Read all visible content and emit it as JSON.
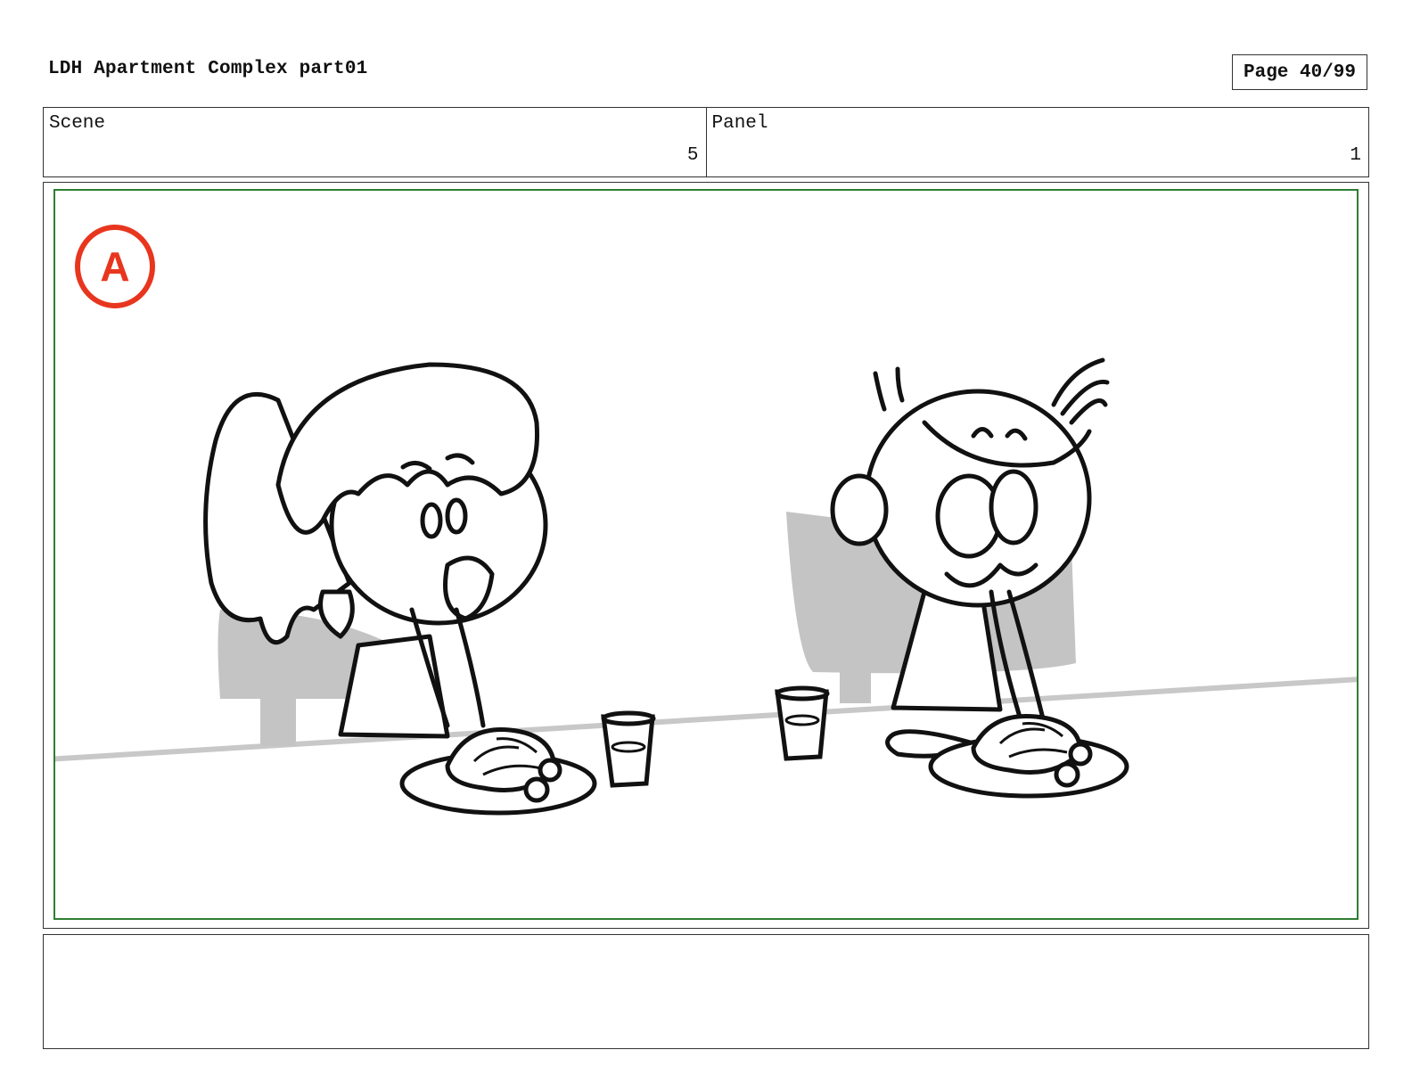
{
  "header": {
    "title": "LDH Apartment Complex part01",
    "page": "Page 40/99"
  },
  "meta": {
    "scene_label": "Scene",
    "scene_value": "5",
    "panel_label": "Panel",
    "panel_value": "1"
  },
  "panel": {
    "marker_letter": "A",
    "marker_color": "#e8361e",
    "frame_color": "#2e7d32",
    "description_icons": [
      "girl-character",
      "boy-character",
      "spaghetti-plate",
      "glass",
      "chair",
      "table-edge"
    ]
  },
  "notes": {
    "text": ""
  }
}
